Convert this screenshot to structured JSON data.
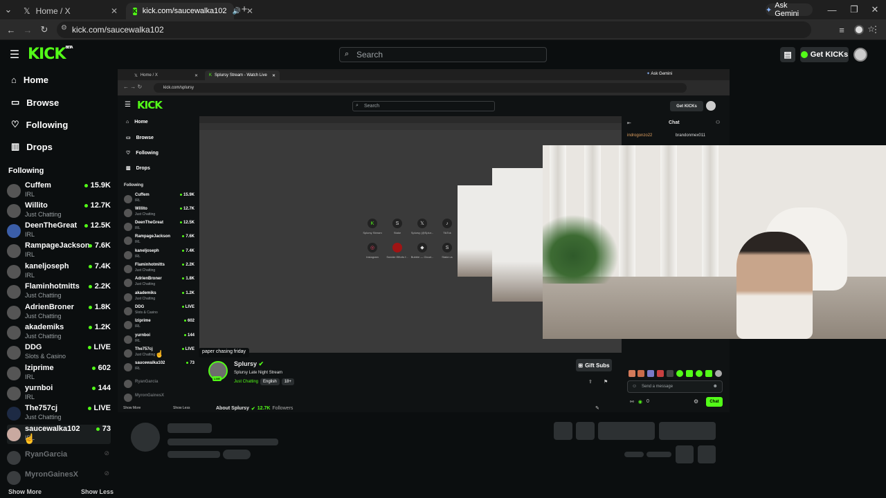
{
  "browser": {
    "tabs": [
      {
        "title": "Home / X",
        "icon": "x-logo-icon"
      },
      {
        "title": "kick.com/saucewalka102",
        "icon": "kick-logo-icon",
        "active": true
      }
    ],
    "new_tab": "+",
    "url": "kick.com/saucewalka102",
    "ask_gemini": "Ask Gemini"
  },
  "kick": {
    "logo": "KICK",
    "logo_sup": "BETA",
    "search_placeholder": "Search",
    "get_kicks": "Get KICKs",
    "nav": [
      {
        "label": "Home",
        "icon": "home-icon"
      },
      {
        "label": "Browse",
        "icon": "browse-icon"
      },
      {
        "label": "Following",
        "icon": "heart-icon"
      },
      {
        "label": "Drops",
        "icon": "drops-icon"
      }
    ],
    "following_title": "Following",
    "following": [
      {
        "name": "Cuffem",
        "category": "IRL",
        "count": "15.9K"
      },
      {
        "name": "Willito",
        "category": "Just Chatting",
        "count": "12.7K"
      },
      {
        "name": "DeenTheGreat",
        "category": "IRL",
        "count": "12.5K"
      },
      {
        "name": "RampageJackson",
        "category": "IRL",
        "count": "7.6K"
      },
      {
        "name": "kaneljoseph",
        "category": "IRL",
        "count": "7.4K"
      },
      {
        "name": "Flaminhotmitts",
        "category": "Just Chatting",
        "count": "2.2K"
      },
      {
        "name": "AdrienBroner",
        "category": "Just Chatting",
        "count": "1.8K"
      },
      {
        "name": "akademiks",
        "category": "Just Chatting",
        "count": "1.2K"
      },
      {
        "name": "DDG",
        "category": "Slots & Casino",
        "count": "LIVE"
      },
      {
        "name": "lziprime",
        "category": "IRL",
        "count": "602"
      },
      {
        "name": "yurnboi",
        "category": "IRL",
        "count": "144"
      },
      {
        "name": "The757cj",
        "category": "Just Chatting",
        "count": "LIVE"
      },
      {
        "name": "saucewalka102",
        "category": "IRL",
        "count": "73"
      }
    ],
    "offline": [
      {
        "name": "RyanGarcia"
      },
      {
        "name": "MyronGainesX"
      }
    ],
    "show_more": "Show More",
    "show_less": "Show Less"
  },
  "inner": {
    "tabs": [
      {
        "title": "Home / X"
      },
      {
        "title": "Splursy Stream - Watch Live"
      }
    ],
    "ask_gemini": "Ask Gemini",
    "url": "kick.com/splursy",
    "search_placeholder": "Search",
    "get_kicks": "Get KICKs",
    "nav": [
      "Home",
      "Browse",
      "Following",
      "Drops"
    ],
    "following_title": "Following",
    "following": [
      {
        "name": "Cuffem",
        "category": "IRL",
        "count": "15.9K"
      },
      {
        "name": "Willito",
        "category": "Just Chatting",
        "count": "12.7K"
      },
      {
        "name": "DeenTheGreat",
        "category": "IRL",
        "count": "12.5K"
      },
      {
        "name": "RampageJackson",
        "category": "IRL",
        "count": "7.6K"
      },
      {
        "name": "kaneljoseph",
        "category": "IRL",
        "count": "7.4K"
      },
      {
        "name": "Flaminhotmitts",
        "category": "Just Chatting",
        "count": "2.2K"
      },
      {
        "name": "AdrienBroner",
        "category": "Just Chatting",
        "count": "1.8K"
      },
      {
        "name": "akademiks",
        "category": "Just Chatting",
        "count": "1.2K"
      },
      {
        "name": "DDG",
        "category": "Slots & Casino",
        "count": "LIVE"
      },
      {
        "name": "lziprime",
        "category": "IRL",
        "count": "602"
      },
      {
        "name": "yurnboi",
        "category": "IRL",
        "count": "144"
      },
      {
        "name": "The757cj",
        "category": "Just Chatting",
        "count": "LIVE"
      },
      {
        "name": "saucewalka102",
        "category": "IRL",
        "count": "73"
      }
    ],
    "offline": [
      {
        "name": "RyanGarcia"
      },
      {
        "name": "MyronGainesX"
      }
    ],
    "show_more": "Show More",
    "show_less": "Show Less",
    "tooltip": "paper chasing friday",
    "chat_title": "Chat",
    "chat_users": [
      "indrogonzo22",
      "brandonmex011"
    ],
    "shortcuts": [
      "Splursy Stream",
      "Stake",
      "Splursy (@Splur...",
      "TikTok",
      "Instagram",
      "Suicide Efforts f...",
      "Bubble — Cloud...",
      "Stake.us"
    ],
    "streamer": "Splursy",
    "stream_title": "Splursy Late Night Stream",
    "category": "Just Chatting",
    "tags": [
      "English",
      "18+"
    ],
    "live_badge": "LIVE",
    "gift_subs": "Gift Subs",
    "about": "About Splursy",
    "followers_count": "12.7K",
    "followers_label": "Followers",
    "send_placeholder": "Send a message",
    "chat_button": "Chat",
    "kicks_count": "0"
  }
}
